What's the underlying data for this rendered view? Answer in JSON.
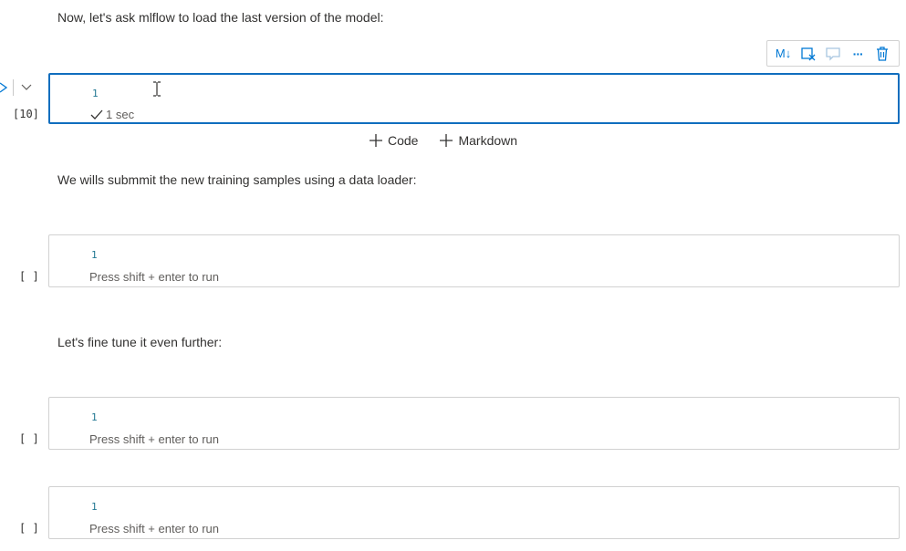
{
  "markdown_cells": {
    "intro": "Now, let's ask mlflow to load the last version of the model:",
    "submit": "We wills submmit the new training samples using a data loader:",
    "finetune": "Let's fine tune it even further:"
  },
  "toolbar": {
    "markdown_label": "M↓",
    "more_label": "···"
  },
  "cells": [
    {
      "exec_count": "[10]",
      "line_number": "1",
      "status": "1 sec"
    },
    {
      "exec_count": "[ ]",
      "line_number": "1",
      "hint": "Press shift + enter to run"
    },
    {
      "exec_count": "[ ]",
      "line_number": "1",
      "hint": "Press shift + enter to run"
    },
    {
      "exec_count": "[ ]",
      "line_number": "1",
      "hint": "Press shift + enter to run"
    }
  ],
  "add_cell": {
    "code_label": "Code",
    "markdown_label": "Markdown"
  },
  "colors": {
    "active_border": "#106ebe",
    "accent": "#0078d4",
    "line_number": "#237893"
  }
}
